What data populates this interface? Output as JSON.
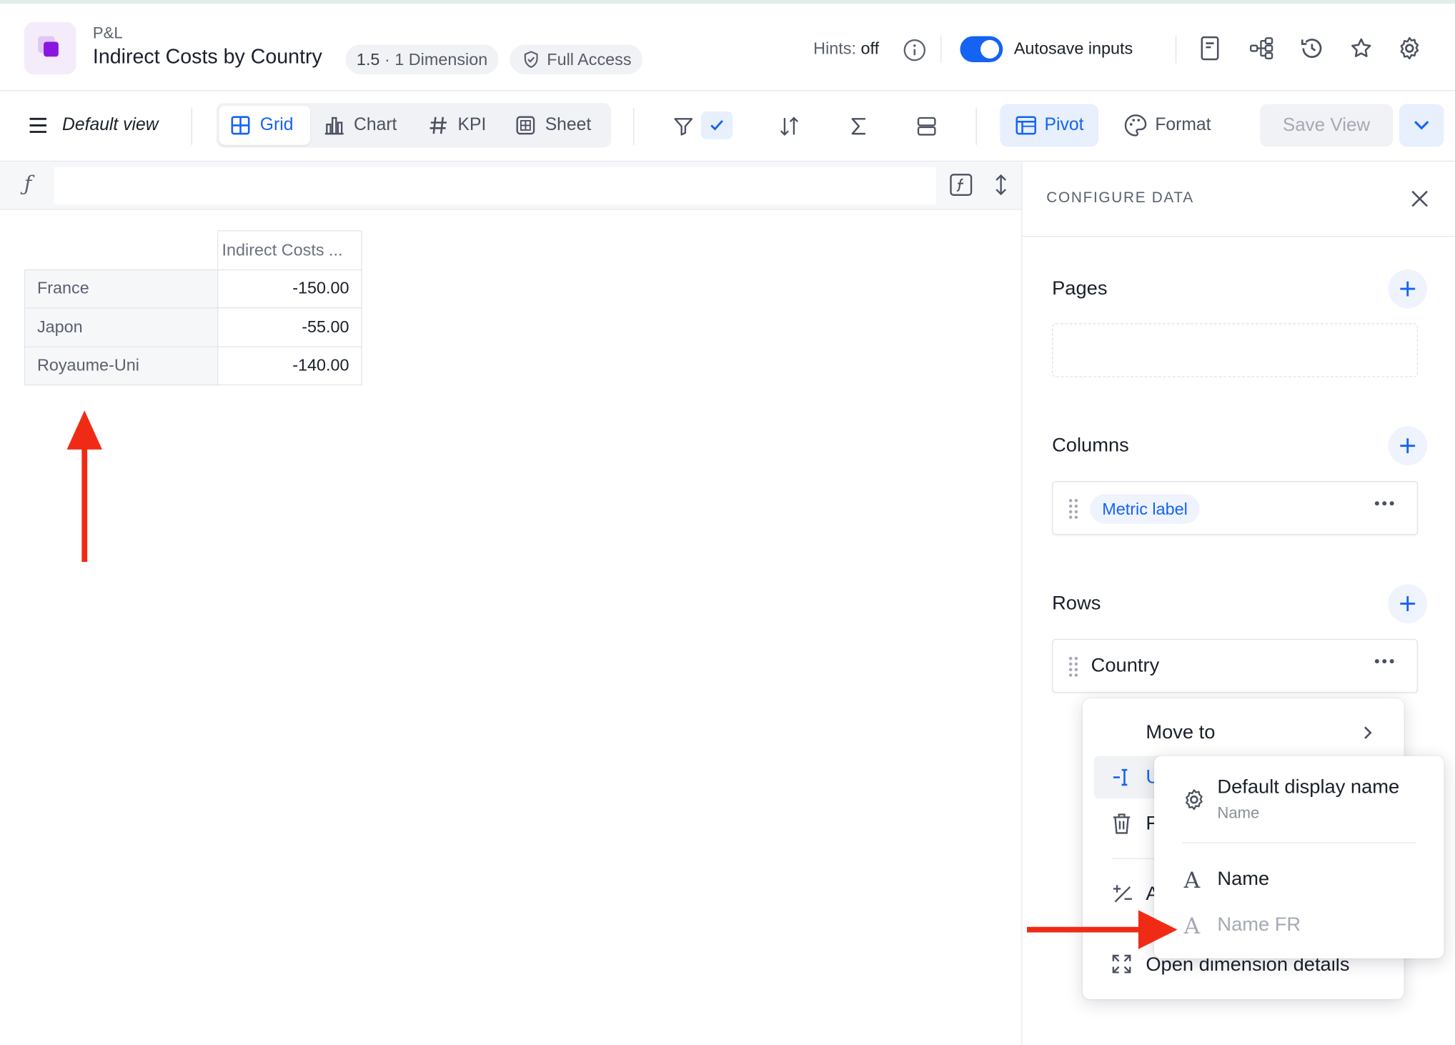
{
  "header": {
    "breadcrumb": "P&L",
    "title": "Indirect Costs by Country",
    "version": "1.5",
    "dimension_badge": "· 1 Dimension",
    "access_badge": "Full Access",
    "hints_label": "Hints:",
    "hints_value": "off",
    "autosave_label": "Autosave inputs",
    "autosave_on": true
  },
  "toolbar": {
    "view_name": "Default view",
    "view_modes": [
      {
        "label": "Grid",
        "icon": "grid-icon",
        "active": true
      },
      {
        "label": "Chart",
        "icon": "bar-chart-icon",
        "active": false
      },
      {
        "label": "KPI",
        "icon": "hash-icon",
        "active": false
      },
      {
        "label": "Sheet",
        "icon": "sheet-icon",
        "active": false
      }
    ],
    "pivot_label": "Pivot",
    "format_label": "Format",
    "save_label": "Save View"
  },
  "formula": {
    "fx": "ƒ",
    "value": ""
  },
  "grid": {
    "column_header": "Indirect Costs ...",
    "rows": [
      {
        "label": "France",
        "value": "-150.00"
      },
      {
        "label": "Japon",
        "value": "-55.00"
      },
      {
        "label": "Royaume-Uni",
        "value": "-140.00"
      }
    ]
  },
  "panel": {
    "title": "CONFIGURE DATA",
    "pages_title": "Pages",
    "columns_title": "Columns",
    "columns_field": "Metric label",
    "rows_title": "Rows",
    "rows_field": "Country"
  },
  "context_menu": {
    "move_to": "Move to",
    "partial_1": "U",
    "partial_2": "F",
    "partial_3": "A",
    "open_details": "Open dimension details"
  },
  "submenu": {
    "default_label": "Default display name",
    "default_sub": "Name",
    "items": [
      {
        "label": "Name",
        "disabled": false
      },
      {
        "label": "Name FR",
        "disabled": true
      }
    ]
  },
  "colors": {
    "accent": "#1463f3",
    "annotation": "#f02b15"
  }
}
